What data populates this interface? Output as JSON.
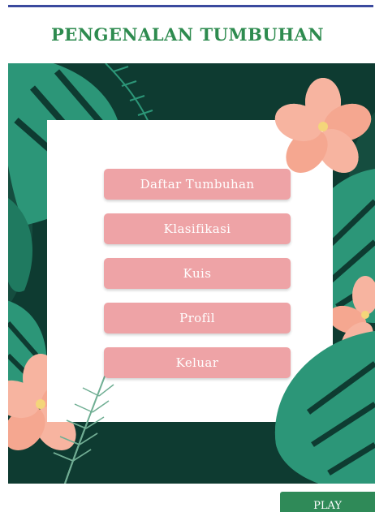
{
  "header": {
    "title": "PENGENALAN TUMBUHAN"
  },
  "menu": {
    "items": [
      {
        "label": "Daftar Tumbuhan"
      },
      {
        "label": "Klasifikasi"
      },
      {
        "label": "Kuis"
      },
      {
        "label": "Profil"
      },
      {
        "label": "Keluar"
      }
    ]
  },
  "footer": {
    "play_label": "PLAY"
  },
  "colors": {
    "title": "#2e8b4f",
    "button": "#eea3a6",
    "background": "#0e3b31",
    "play": "#2f8a58"
  }
}
